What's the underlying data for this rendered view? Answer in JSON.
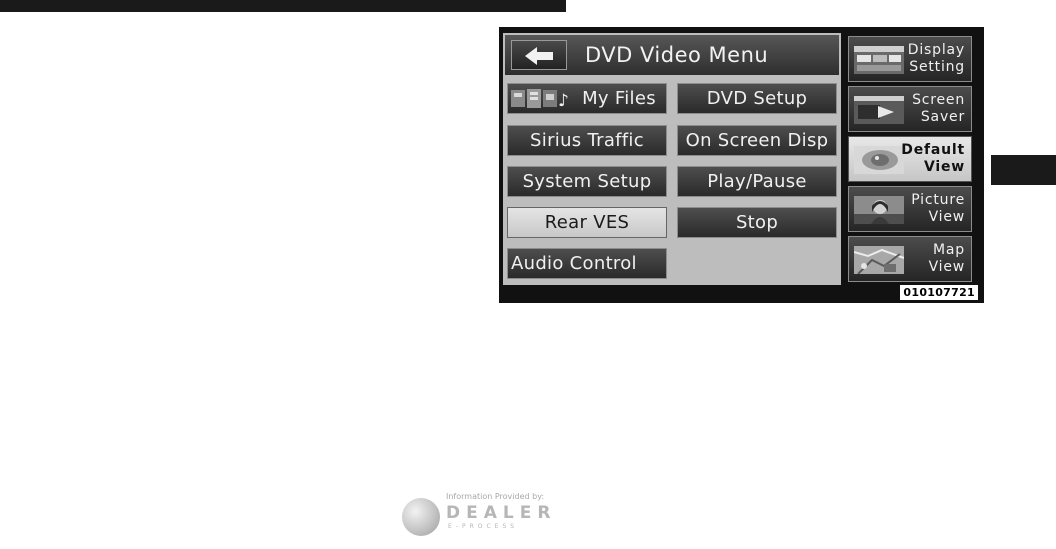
{
  "header": {
    "title": "DVD Video Menu",
    "back_icon": "back-arrow-icon"
  },
  "menu": {
    "my_files": "My Files",
    "dvd_setup": "DVD Setup",
    "sirius_traffic": "Sirius Traffic",
    "on_screen_disp": "On Screen Disp",
    "system_setup": "System Setup",
    "play_pause": "Play/Pause",
    "rear_ves": "Rear VES",
    "stop": "Stop",
    "audio_control": "Audio Control"
  },
  "side_menu": {
    "display_setting_1": "Display",
    "display_setting_2": "Setting",
    "screen_saver_1": "Screen",
    "screen_saver_2": "Saver",
    "default_view_1": "Default",
    "default_view_2": "View",
    "picture_view_1": "Picture",
    "picture_view_2": "View",
    "map_view_1": "Map",
    "map_view_2": "View"
  },
  "image_code": "010107721",
  "footer": {
    "info_text": "Information Provided by:",
    "brand": "DEALER",
    "sub": "E-PROCESS"
  },
  "colors": {
    "button_dark": "#2f2f2f",
    "button_active": "#d6d6d6",
    "panel_bg": "#bdbdbd",
    "frame": "#111111"
  }
}
